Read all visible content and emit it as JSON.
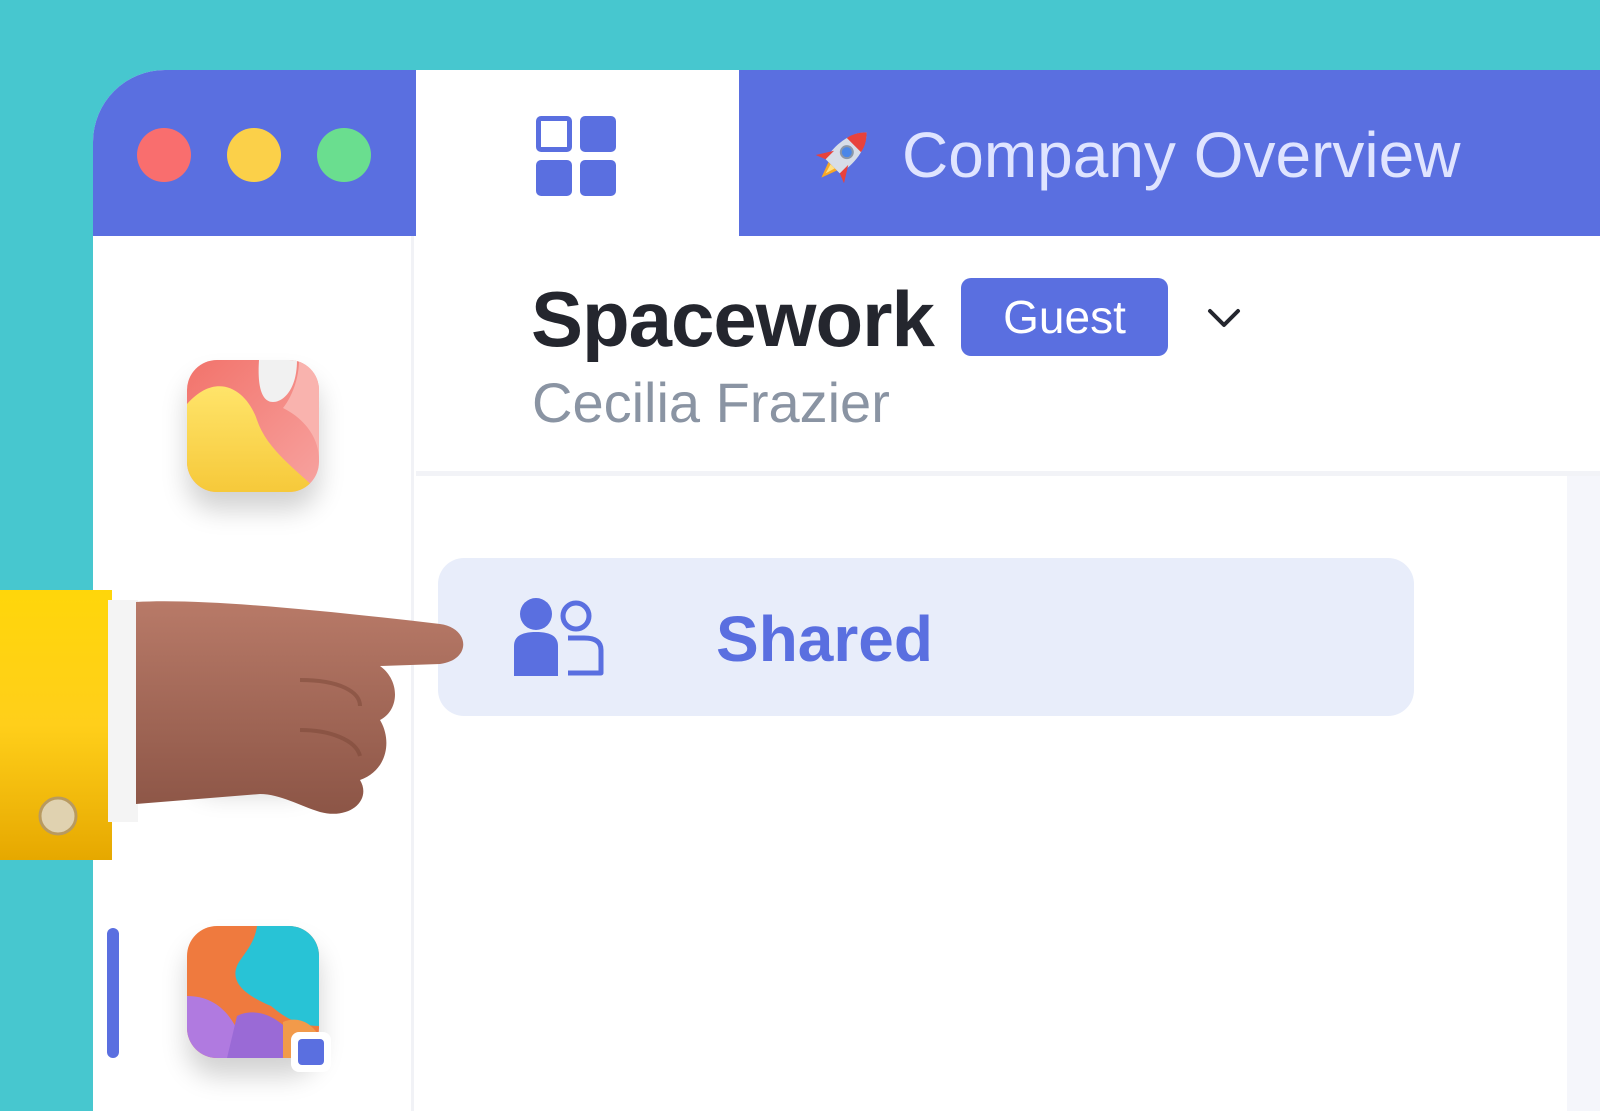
{
  "titlebar": {
    "tab_title": "Company Overview",
    "tab_icon": "rocket-icon",
    "active_tab_icon": "grid-icon"
  },
  "sidebar": {
    "apps": [
      {
        "name": "app-icon-pink-yellow"
      },
      {
        "name": "app-icon-green-teal"
      },
      {
        "name": "app-icon-orange-purple-teal",
        "active": true
      }
    ]
  },
  "header": {
    "workspace_name": "Spacework",
    "role_badge": "Guest",
    "user_name": "Cecilia Frazier"
  },
  "nav": {
    "shared_label": "Shared",
    "shared_icon": "users-icon"
  },
  "colors": {
    "background": "#47c7cf",
    "accent": "#5a6fe0",
    "nav_selected_bg": "#e8edfa",
    "traffic_red": "#f96e6e",
    "traffic_yellow": "#fbd049",
    "traffic_green": "#6ade8f"
  }
}
